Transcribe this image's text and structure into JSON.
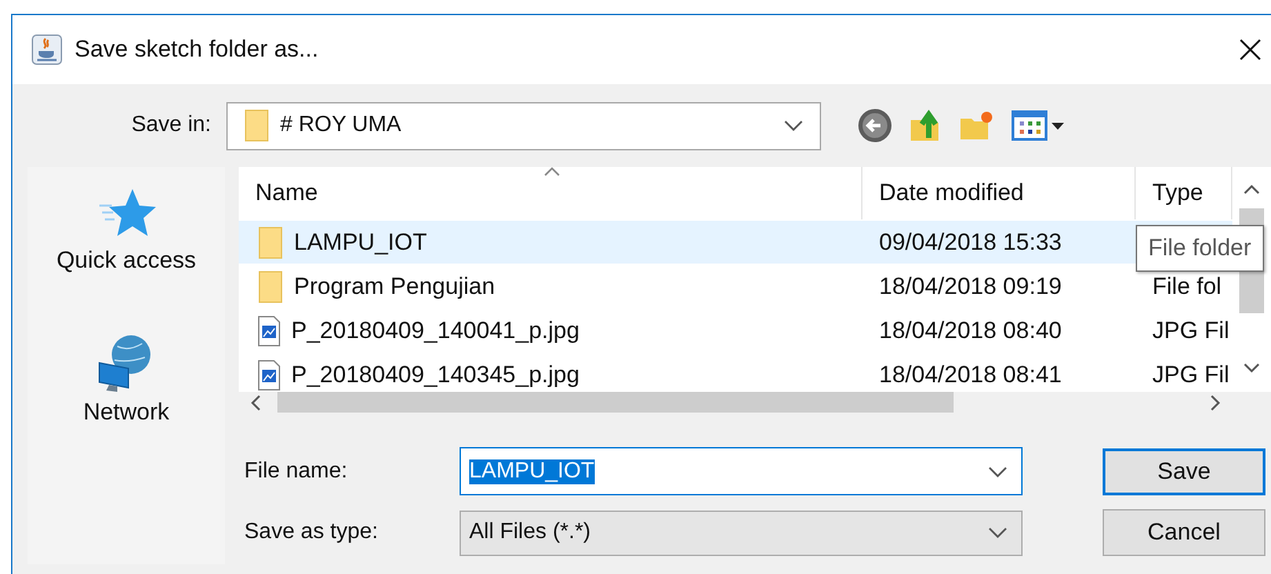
{
  "window": {
    "title": "Save sketch folder as..."
  },
  "save_in": {
    "label": "Save in:",
    "value": "# ROY UMA"
  },
  "places": [
    {
      "kind": "quick_access",
      "label": "Quick access"
    },
    {
      "kind": "network",
      "label": "Network"
    }
  ],
  "file_list": {
    "columns": [
      "Name",
      "Date modified",
      "Type"
    ],
    "rows": [
      {
        "kind": "folder",
        "name": "LAMPU_IOT",
        "date": "09/04/2018 15:33",
        "selected": true
      },
      {
        "kind": "folder",
        "name": "Program Pengujian",
        "date": "18/04/2018 09:19",
        "type": "File fol",
        "selected": false
      },
      {
        "kind": "image",
        "name": "P_20180409_140041_p.jpg",
        "date": "18/04/2018 08:40",
        "type": "JPG Fil",
        "selected": false
      },
      {
        "kind": "image",
        "name": "P_20180409_140345_p.jpg",
        "date": "18/04/2018 08:41",
        "type": "JPG Fil",
        "selected": false
      }
    ],
    "tooltip": "File folder"
  },
  "file_name": {
    "label": "File name:",
    "value": "LAMPU_IOT",
    "text_selected": true
  },
  "save_as_type": {
    "label": "Save as type:",
    "value": "All Files (*.*)"
  },
  "buttons": [
    {
      "label": "Save",
      "default": true
    },
    {
      "label": "Cancel",
      "default": false
    }
  ]
}
